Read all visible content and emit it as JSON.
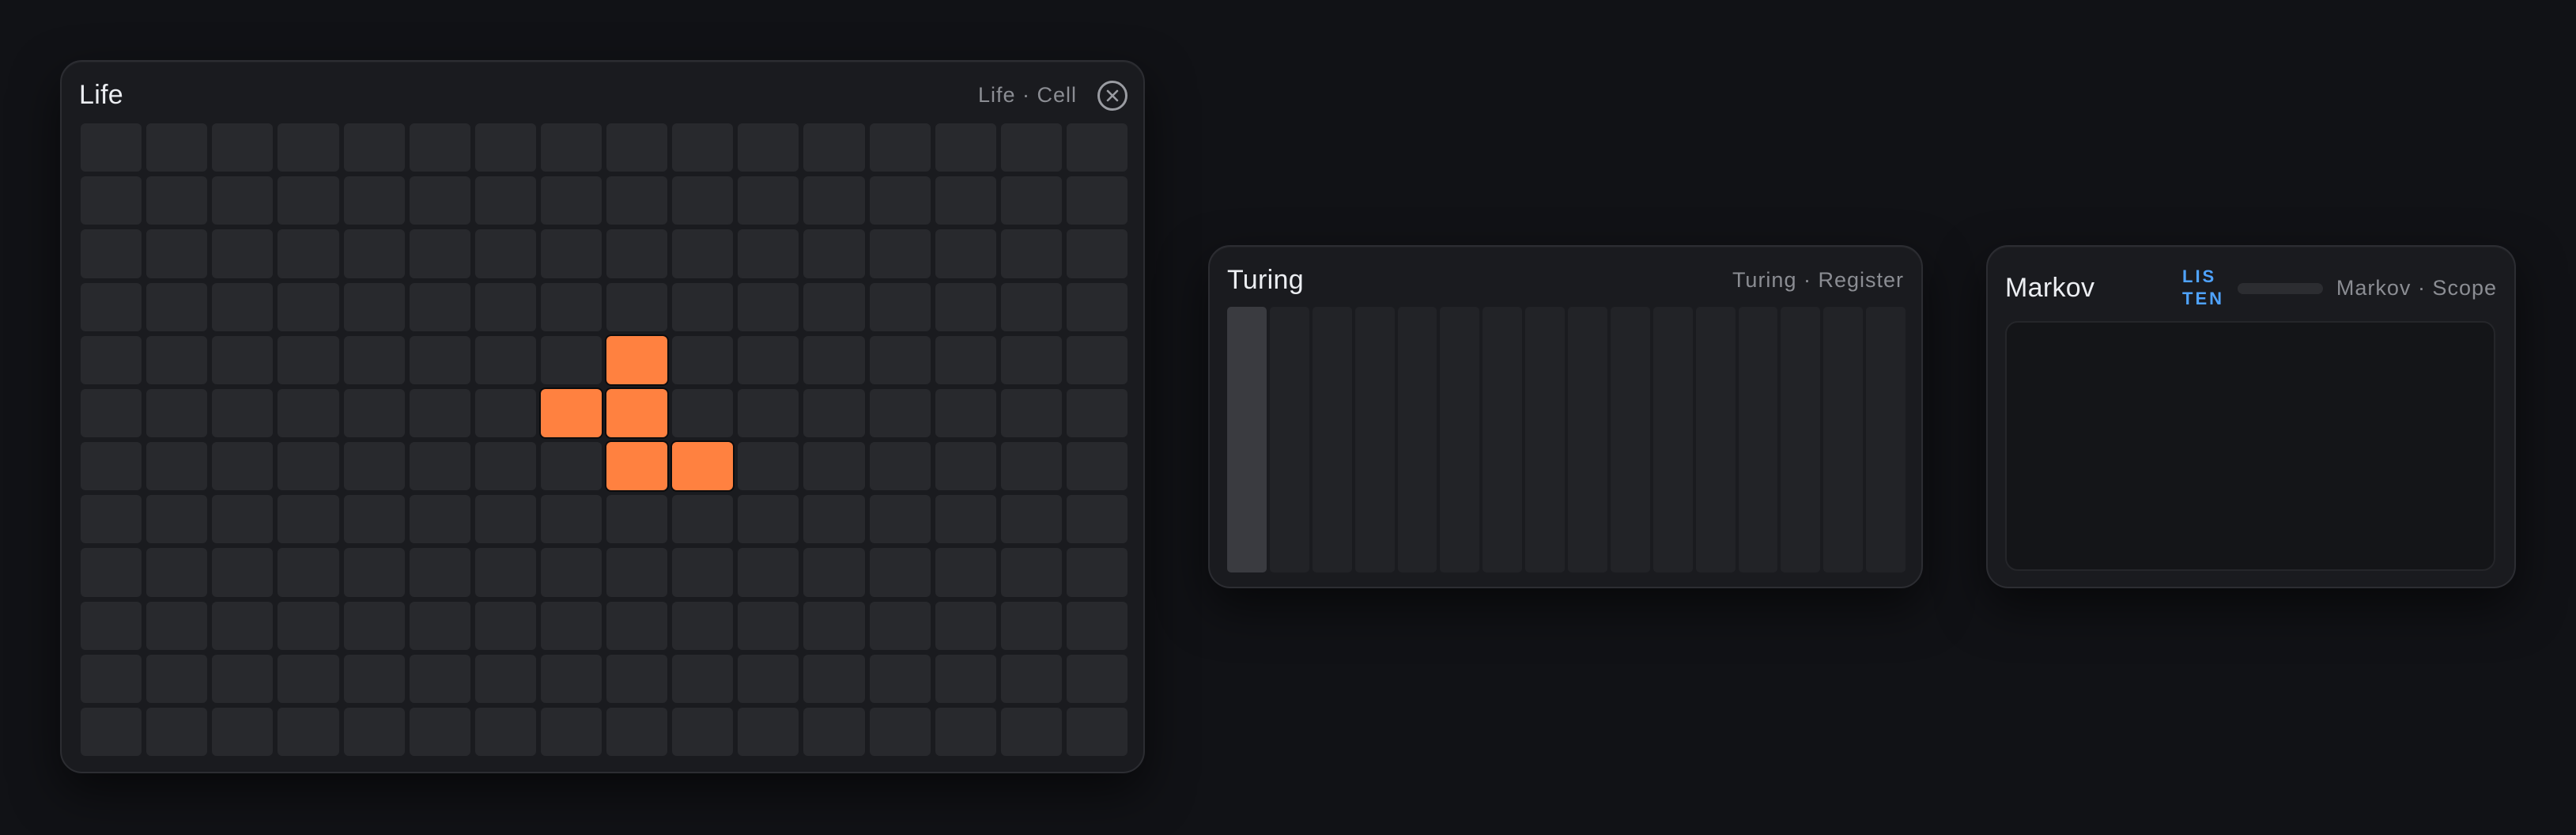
{
  "life": {
    "title": "Life",
    "meta": "Life · Cell",
    "grid": {
      "columns": 16,
      "rows": 12,
      "alive_cells": [
        [
          4,
          8
        ],
        [
          5,
          7
        ],
        [
          5,
          8
        ],
        [
          6,
          8
        ],
        [
          6,
          9
        ]
      ]
    },
    "colors": {
      "cell": "#28292d",
      "alive": "#ff8140"
    }
  },
  "turing": {
    "title": "Turing",
    "meta": "Turing · Register",
    "register": {
      "bits": [
        1,
        0,
        0,
        0,
        0,
        0,
        0,
        0,
        0,
        0,
        0,
        0,
        0,
        0,
        0,
        0
      ]
    }
  },
  "markov": {
    "title": "Markov",
    "listen_label": "LISTEN",
    "listen_lines": [
      "LIS",
      "TEN"
    ],
    "meta": "Markov · Scope",
    "level": 0,
    "colors": {
      "accent": "#4fa3ff"
    }
  }
}
